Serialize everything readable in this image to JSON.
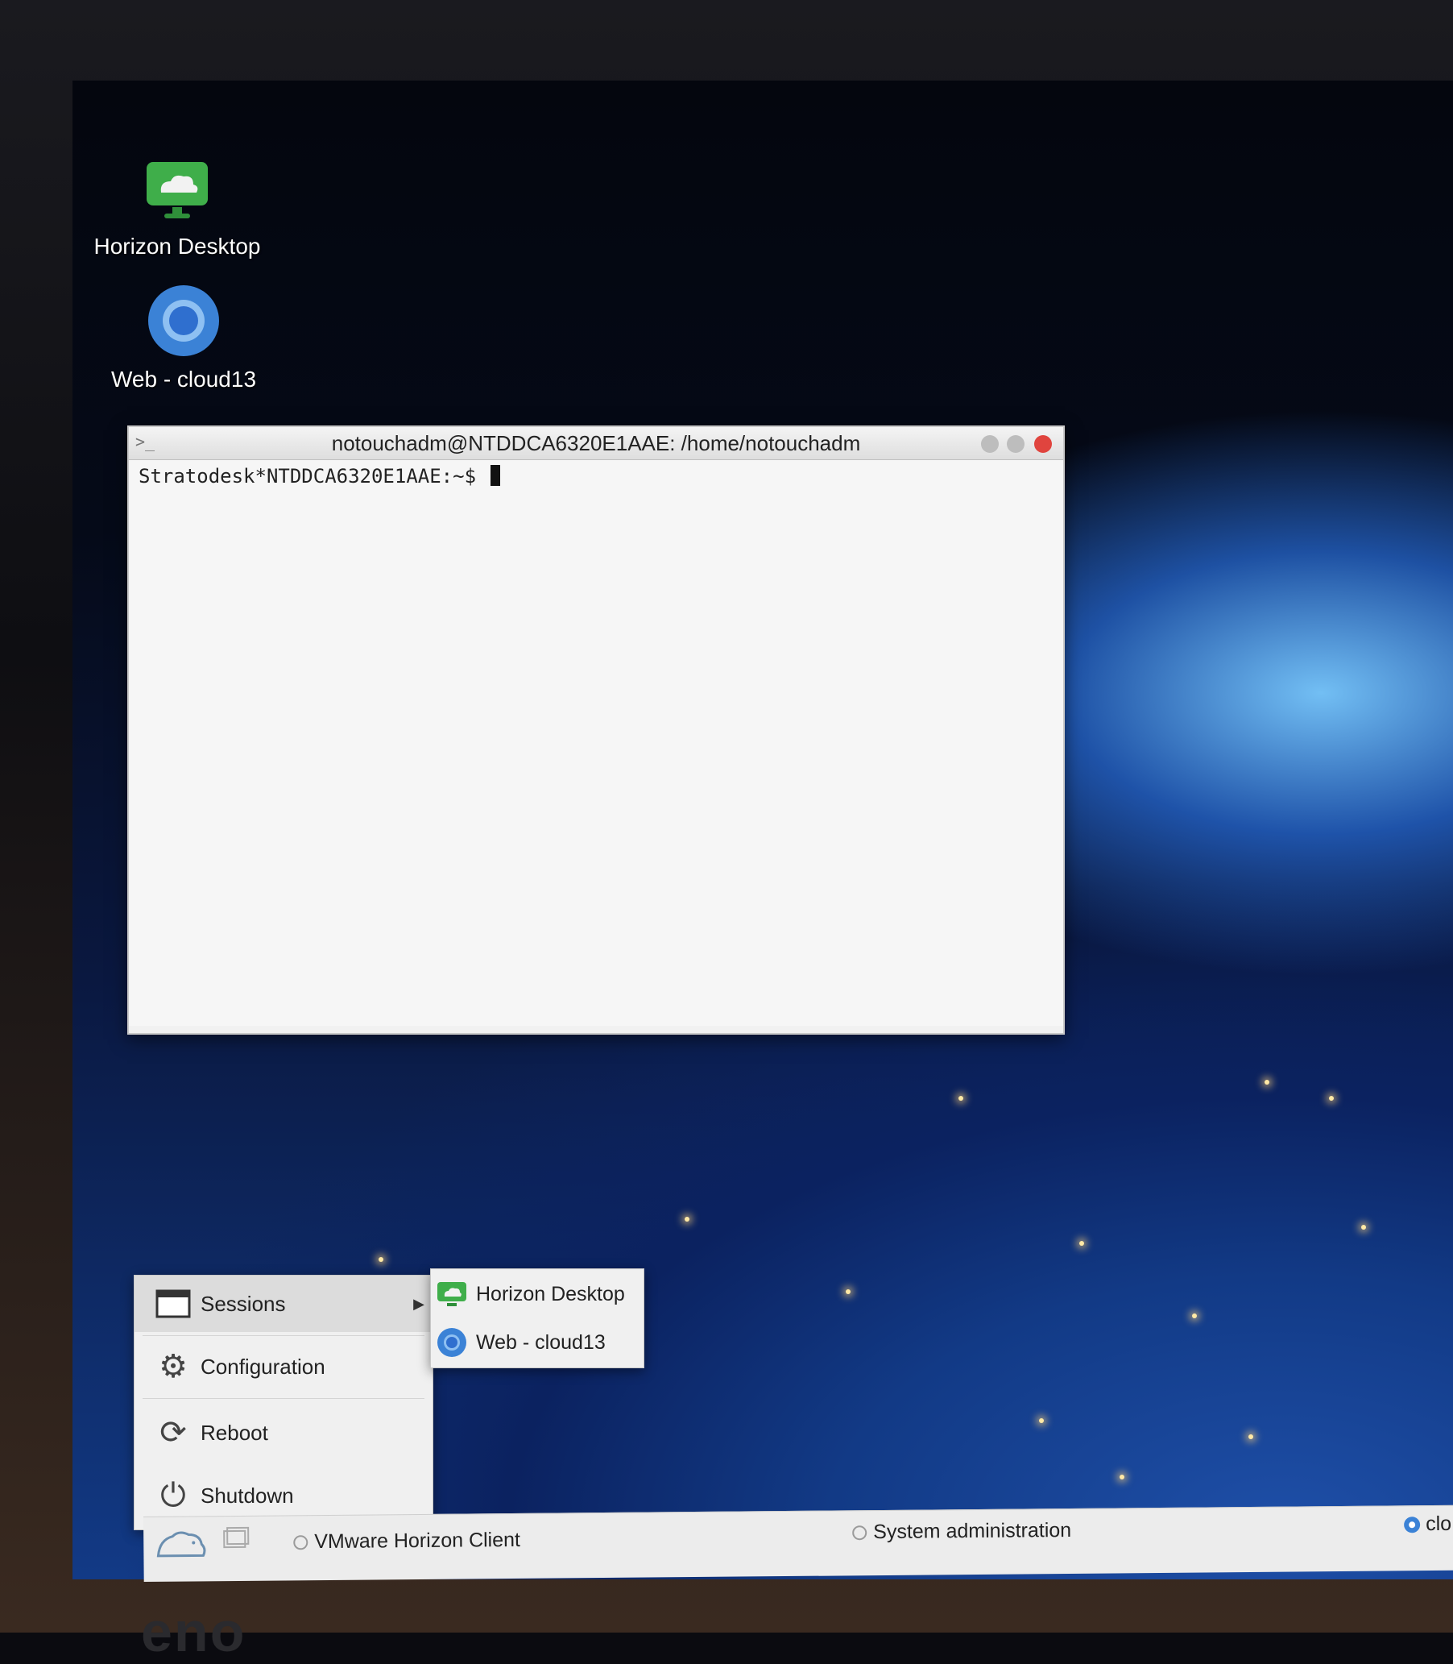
{
  "desktop": {
    "icons": [
      {
        "label": "Horizon Desktop",
        "icon": "horizon-cloud-monitor-icon"
      },
      {
        "label": "Web - cloud13",
        "icon": "chromium-icon"
      }
    ]
  },
  "terminal": {
    "title": "notouchadm@NTDDCA6320E1AAE: /home/notouchadm",
    "prompt": "Stratodesk*NTDDCA6320E1AAE:~$ ",
    "title_icon": ">_"
  },
  "start_menu": {
    "items": [
      {
        "label": "Sessions",
        "icon": "window-icon",
        "highlighted": true,
        "has_submenu": true
      },
      {
        "label": "Configuration",
        "icon": "gear-icon"
      },
      {
        "label": "Reboot",
        "icon": "reboot-icon"
      },
      {
        "label": "Shutdown",
        "icon": "power-icon"
      }
    ],
    "submenu": [
      {
        "label": "Horizon Desktop",
        "icon": "horizon-cloud-monitor-icon"
      },
      {
        "label": "Web - cloud13",
        "icon": "chromium-icon"
      }
    ]
  },
  "taskbar": {
    "tasks": [
      {
        "label": "VMware Horizon Client"
      },
      {
        "label": "System administration"
      },
      {
        "label": "clo"
      }
    ]
  },
  "monitor": {
    "brand_fragment": "eno"
  },
  "colors": {
    "close_button": "#e0443e",
    "terminal_bg": "#f6f6f6",
    "horizon_green": "#3fae4a",
    "chromium_blue": "#3b82d6"
  }
}
